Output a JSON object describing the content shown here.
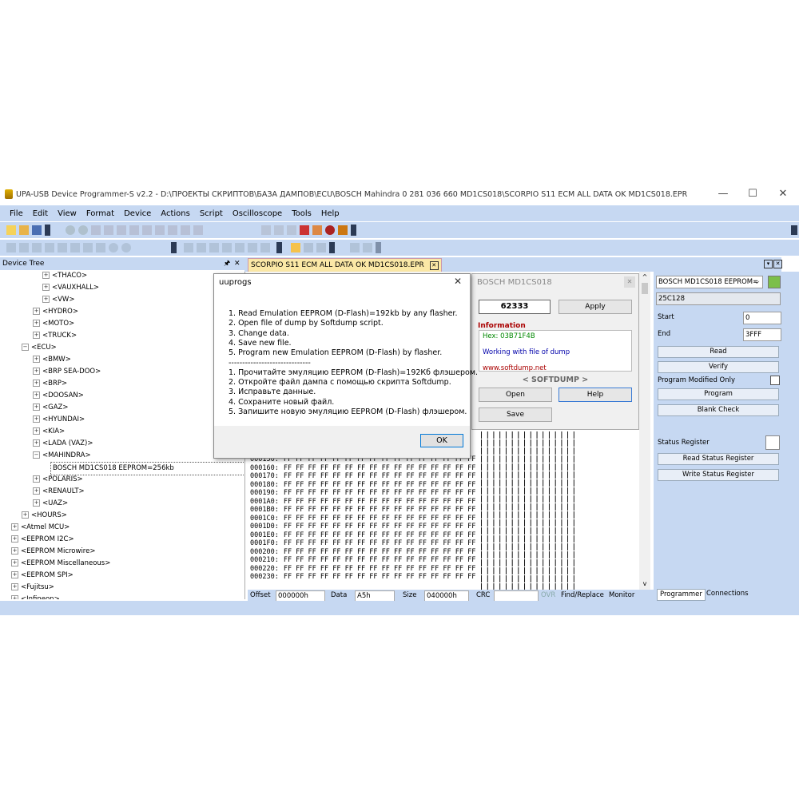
{
  "window": {
    "title": "UPA-USB Device Programmer-S v2.2 - D:\\ПРОЕКТЫ СКРИПТОВ\\БАЗА ДАМПОВ\\ECU\\BOSCH Mahindra 0 281 036 660 MD1CS018\\SCORPIO S11 ECM ALL DATA OK MD1CS018.EPR",
    "minimize": "—",
    "maximize": "☐",
    "close": "✕"
  },
  "menu": [
    "File",
    "Edit",
    "View",
    "Format",
    "Device",
    "Actions",
    "Script",
    "Oscilloscope",
    "Tools",
    "Help"
  ],
  "tree": {
    "header": "Device Tree",
    "pin": "🖈",
    "close": "✕",
    "nodes": [
      {
        "label": "<THACO>",
        "level": 3,
        "exp": "+"
      },
      {
        "label": "<VAUXHALL>",
        "level": 3,
        "exp": "+"
      },
      {
        "label": "<VW>",
        "level": 3,
        "exp": "+"
      },
      {
        "label": "<HYDRO>",
        "level": 2,
        "exp": "+"
      },
      {
        "label": "<MOTO>",
        "level": 2,
        "exp": "+"
      },
      {
        "label": "<TRUCK>",
        "level": 2,
        "exp": "+"
      },
      {
        "label": "<ECU>",
        "level": 1,
        "exp": "−"
      },
      {
        "label": "<BMW>",
        "level": 2,
        "exp": "+"
      },
      {
        "label": "<BRP SEA-DOO>",
        "level": 2,
        "exp": "+"
      },
      {
        "label": "<BRP>",
        "level": 2,
        "exp": "+"
      },
      {
        "label": "<DOOSAN>",
        "level": 2,
        "exp": "+"
      },
      {
        "label": "<GAZ>",
        "level": 2,
        "exp": "+"
      },
      {
        "label": "<HYUNDAI>",
        "level": 2,
        "exp": "+"
      },
      {
        "label": "<KIA>",
        "level": 2,
        "exp": "+"
      },
      {
        "label": "<LADA (VAZ)>",
        "level": 2,
        "exp": "+"
      },
      {
        "label": "<MAHINDRA>",
        "level": 2,
        "exp": "−"
      },
      {
        "label": "BOSCH MD1CS018 EEPROM=256kb",
        "level": 4,
        "exp": ""
      },
      {
        "label": "<POLARIS>",
        "level": 2,
        "exp": "+"
      },
      {
        "label": "<RENAULT>",
        "level": 2,
        "exp": "+"
      },
      {
        "label": "<UAZ>",
        "level": 2,
        "exp": "+"
      },
      {
        "label": "<HOURS>",
        "level": 1,
        "exp": "+"
      },
      {
        "label": "<Atmel MCU>",
        "level": 0,
        "exp": "+"
      },
      {
        "label": "<EEPROM I2C>",
        "level": 0,
        "exp": "+"
      },
      {
        "label": "<EEPROM Microwire>",
        "level": 0,
        "exp": "+"
      },
      {
        "label": "<EEPROM Miscellaneous>",
        "level": 0,
        "exp": "+"
      },
      {
        "label": "<EEPROM SPI>",
        "level": 0,
        "exp": "+"
      },
      {
        "label": "<Fujitsu>",
        "level": 0,
        "exp": "+"
      },
      {
        "label": "<Infineon>",
        "level": 0,
        "exp": "+"
      }
    ]
  },
  "editor": {
    "tab": "SCORPIO S11 ECM ALL DATA OK MD1CS018.EPR",
    "tab_close": "✕",
    "hex_rows": [
      {
        "addr": "000150:",
        "bytes": "FF FF FF FF FF FF FF FF FF FF FF FF FF FF FF FF"
      },
      {
        "addr": "000160:",
        "bytes": "FF FF FF FF FF FF FF FF FF FF FF FF FF FF FF FF"
      },
      {
        "addr": "000170:",
        "bytes": "FF FF FF FF FF FF FF FF FF FF FF FF FF FF FF FF"
      },
      {
        "addr": "000180:",
        "bytes": "FF FF FF FF FF FF FF FF FF FF FF FF FF FF FF FF"
      },
      {
        "addr": "000190:",
        "bytes": "FF FF FF FF FF FF FF FF FF FF FF FF FF FF FF FF"
      },
      {
        "addr": "0001A0:",
        "bytes": "FF FF FF FF FF FF FF FF FF FF FF FF FF FF FF FF"
      },
      {
        "addr": "0001B0:",
        "bytes": "FF FF FF FF FF FF FF FF FF FF FF FF FF FF FF FF"
      },
      {
        "addr": "0001C0:",
        "bytes": "FF FF FF FF FF FF FF FF FF FF FF FF FF FF FF FF"
      },
      {
        "addr": "0001D0:",
        "bytes": "FF FF FF FF FF FF FF FF FF FF FF FF FF FF FF FF"
      },
      {
        "addr": "0001E0:",
        "bytes": "FF FF FF FF FF FF FF FF FF FF FF FF FF FF FF FF"
      },
      {
        "addr": "0001F0:",
        "bytes": "FF FF FF FF FF FF FF FF FF FF FF FF FF FF FF FF"
      },
      {
        "addr": "000200:",
        "bytes": "FF FF FF FF FF FF FF FF FF FF FF FF FF FF FF FF"
      },
      {
        "addr": "000210:",
        "bytes": "FF FF FF FF FF FF FF FF FF FF FF FF FF FF FF FF"
      },
      {
        "addr": "000220:",
        "bytes": "FF FF FF FF FF FF FF FF FF FF FF FF FF FF FF FF"
      },
      {
        "addr": "000230:",
        "bytes": "FF FF FF FF FF FF FF FF FF FF FF FF FF FF FF FF"
      }
    ],
    "ascii": "||||||||||||||||"
  },
  "statusbar": {
    "offset_label": "Offset",
    "offset_value": "000000h",
    "data_label": "Data",
    "data_value": "A5h",
    "size_label": "Size",
    "size_value": "040000h",
    "crc_label": "CRC",
    "ovr": "OVR",
    "find_replace": "Find/Replace",
    "monitor": "Monitor"
  },
  "softdump": {
    "title": "BOSCH MD1CS018",
    "code": "62333",
    "apply": "Apply",
    "info_label": "Information",
    "hex": "Hex: 03B71F4B",
    "working": "Working with file of dump",
    "url": "www.softdump.net",
    "brand": "< SOFTDUMP >",
    "open": "Open",
    "help": "Help",
    "save": "Save"
  },
  "dialog": {
    "title": "uuprogs",
    "close": "✕",
    "en_lines": [
      "1. Read Emulation EEPROM (D-Flash)=192kb by any flasher.",
      "2. Open file of dump by Softdump script.",
      "3. Change data.",
      "4. Save new file.",
      "5. Program new Emulation EEPROM (D-Flash) by flasher."
    ],
    "separator": "------------------------------",
    "ru_lines": [
      "1. Прочитайте эмуляцию EEPROM (D-Flash)=192Кб флэшером.",
      "2. Откройте файл дампа с помощью скрипта Softdump.",
      "3. Исправьте данные.",
      "4. Сохраните новый файл.",
      "5. Запишите новую эмуляцию EEPROM (D-Flash) флэшером."
    ],
    "ok": "OK"
  },
  "rightpanel": {
    "device": "BOSCH MD1CS018 EEPROM=",
    "chip": "25C128",
    "start_label": "Start",
    "start_value": "0",
    "end_label": "End",
    "end_value": "3FFF",
    "read": "Read",
    "verify": "Verify",
    "program_modified": "Program Modified Only",
    "program": "Program",
    "blank_check": "Blank Check",
    "status_register": "Status Register",
    "read_status": "Read Status Register",
    "write_status": "Write Status Register",
    "tab_programmer": "Programmer",
    "tab_connections": "Connections"
  }
}
